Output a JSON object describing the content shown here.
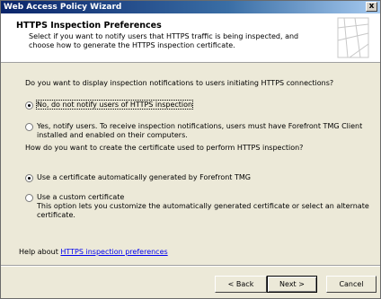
{
  "window": {
    "title": "Web Access Policy Wizard",
    "close_glyph": "x"
  },
  "header": {
    "title": "HTTPS Inspection Preferences",
    "subtitle": "Select if you want to notify users that HTTPS traffic is being inspected, and choose how to generate the HTTPS inspection certificate."
  },
  "notify": {
    "question": "Do you want to display inspection notifications to users initiating HTTPS connections?",
    "options": [
      {
        "label": "No, do not notify users of HTTPS inspection",
        "checked": true
      },
      {
        "label": "Yes, notify users. To receive inspection notifications, users must have Forefront TMG Client installed and enabled on their computers.",
        "checked": false
      }
    ]
  },
  "certificate": {
    "question": "How do you want to create the certificate used to perform HTTPS inspection?",
    "options": [
      {
        "label": "Use a certificate automatically generated by Forefront TMG",
        "checked": true
      },
      {
        "label": "Use a custom certificate",
        "description": "This option lets you customize the automatically generated certificate or select an alternate certificate.",
        "checked": false
      }
    ]
  },
  "help": {
    "prefix": "Help about ",
    "link": "HTTPS inspection preferences"
  },
  "buttons": {
    "back": "< Back",
    "next": "Next >",
    "cancel": "Cancel"
  }
}
